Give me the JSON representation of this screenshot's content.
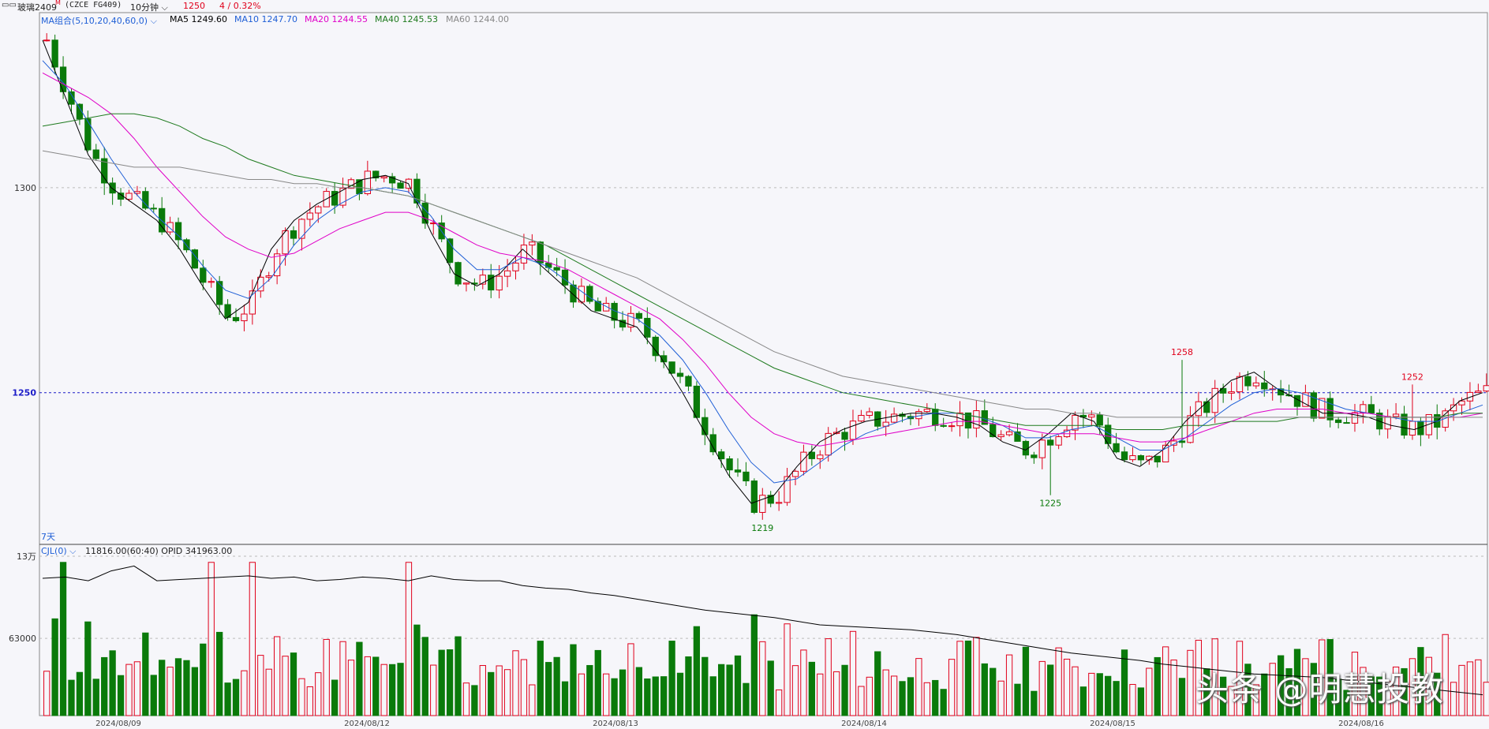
{
  "header": {
    "icon": "window-restore-icon",
    "symbol": "玻璃2409",
    "badge": "M",
    "code": "(CZCE FG409)",
    "period": "10分钟",
    "price": "1250",
    "change": "4 / 0.32%",
    "colors": {
      "price": "#e0001b",
      "change": "#e0001b"
    }
  },
  "ma_legend": {
    "group": "MA组合(5,10,20,40,60,0)",
    "items": [
      {
        "label": "MA5",
        "value": "1249.60",
        "color": "#000000"
      },
      {
        "label": "MA10",
        "value": "1247.70",
        "color": "#1f5fd6"
      },
      {
        "label": "MA20",
        "value": "1244.55",
        "color": "#e000c8"
      },
      {
        "label": "MA40",
        "value": "1245.53",
        "color": "#1e7a1e"
      },
      {
        "label": "MA60",
        "value": "1244.00",
        "color": "#888888"
      }
    ]
  },
  "volume_legend": {
    "label": "CJL(0)",
    "values": "11816.00(60:40)  OPID 341963.00"
  },
  "range_label": "7天",
  "watermark": "头条 @明慧投教",
  "colors": {
    "up": "#e0001b",
    "down": "#0a7a0a",
    "last_price_line": "#1c1cc8",
    "grid": "#bbbbbb"
  },
  "chart_data": {
    "type": "candlestick",
    "title": "",
    "price_axis": {
      "ticks": [
        1300,
        1250
      ],
      "highlight": 1250,
      "ylim": [
        1213,
        1340
      ]
    },
    "volume_axis": {
      "ticks": [
        "13万",
        "63000"
      ],
      "ylim": [
        0,
        130000
      ]
    },
    "x_labels": [
      "2024/08/09",
      "2024/08/12",
      "2024/08/13",
      "2024/08/14",
      "2024/08/15",
      "2024/08/16"
    ],
    "annotations": [
      {
        "text": "1258",
        "value": 1258,
        "kind": "high"
      },
      {
        "text": "1252",
        "value": 1252,
        "kind": "high"
      },
      {
        "text": "1219",
        "value": 1219,
        "kind": "low"
      },
      {
        "text": "1225",
        "value": 1225,
        "kind": "low"
      }
    ],
    "ma_series": [
      {
        "name": "MA5",
        "color": "#000000",
        "values": [
          1336,
          1322,
          1308,
          1300,
          1296,
          1292,
          1285,
          1276,
          1268,
          1272,
          1285,
          1292,
          1296,
          1299,
          1302,
          1303,
          1301,
          1289,
          1279,
          1276,
          1279,
          1285,
          1280,
          1275,
          1270,
          1268,
          1266,
          1259,
          1250,
          1240,
          1230,
          1223,
          1225,
          1232,
          1238,
          1241,
          1243,
          1244,
          1245,
          1245,
          1244,
          1242,
          1238,
          1236,
          1240,
          1245,
          1243,
          1234,
          1232,
          1236,
          1243,
          1248,
          1253,
          1255,
          1251,
          1248,
          1245,
          1245,
          1244,
          1242,
          1241,
          1243,
          1248,
          1250
        ]
      },
      {
        "name": "MA10",
        "color": "#1f5fd6",
        "values": [
          1331,
          1325,
          1316,
          1307,
          1299,
          1293,
          1288,
          1281,
          1275,
          1273,
          1278,
          1286,
          1292,
          1296,
          1299,
          1300,
          1299,
          1293,
          1285,
          1280,
          1280,
          1283,
          1281,
          1277,
          1273,
          1270,
          1268,
          1264,
          1258,
          1250,
          1241,
          1233,
          1228,
          1229,
          1233,
          1237,
          1240,
          1242,
          1244,
          1245,
          1245,
          1244,
          1242,
          1239,
          1239,
          1241,
          1242,
          1239,
          1236,
          1236,
          1239,
          1243,
          1247,
          1250,
          1251,
          1250,
          1248,
          1246,
          1245,
          1244,
          1243,
          1243,
          1245,
          1247
        ]
      },
      {
        "name": "MA20",
        "color": "#e000c8",
        "values": [
          1328,
          1325,
          1322,
          1318,
          1312,
          1305,
          1299,
          1293,
          1288,
          1285,
          1283,
          1284,
          1287,
          1290,
          1292,
          1294,
          1294,
          1292,
          1289,
          1286,
          1284,
          1283,
          1282,
          1280,
          1277,
          1274,
          1271,
          1268,
          1263,
          1257,
          1250,
          1244,
          1240,
          1238,
          1237,
          1238,
          1239,
          1240,
          1241,
          1242,
          1243,
          1243,
          1242,
          1241,
          1240,
          1240,
          1240,
          1239,
          1238,
          1238,
          1239,
          1241,
          1243,
          1245,
          1246,
          1246,
          1246,
          1245,
          1245,
          1244,
          1244,
          1244,
          1244,
          1245
        ]
      },
      {
        "name": "MA40",
        "color": "#1e7a1e",
        "values": [
          1315,
          1316,
          1317,
          1318,
          1318,
          1317,
          1315,
          1312,
          1310,
          1307,
          1305,
          1303,
          1302,
          1301,
          1300,
          1299,
          1298,
          1296,
          1294,
          1292,
          1290,
          1288,
          1286,
          1283,
          1280,
          1277,
          1274,
          1271,
          1268,
          1265,
          1262,
          1259,
          1256,
          1254,
          1252,
          1250,
          1249,
          1248,
          1247,
          1246,
          1245,
          1244,
          1243,
          1242,
          1242,
          1242,
          1242,
          1241,
          1241,
          1241,
          1242,
          1242,
          1243,
          1243,
          1243,
          1244,
          1244,
          1244,
          1244,
          1244,
          1244,
          1244,
          1245,
          1245
        ]
      },
      {
        "name": "MA60",
        "color": "#888888",
        "values": [
          1309,
          1308,
          1307,
          1306,
          1305,
          1305,
          1305,
          1304,
          1303,
          1302,
          1302,
          1301,
          1301,
          1300,
          1300,
          1299,
          1298,
          1296,
          1294,
          1292,
          1290,
          1288,
          1286,
          1284,
          1282,
          1280,
          1278,
          1275,
          1272,
          1269,
          1266,
          1263,
          1260,
          1258,
          1256,
          1254,
          1253,
          1252,
          1251,
          1250,
          1249,
          1248,
          1247,
          1246,
          1246,
          1245,
          1245,
          1244,
          1244,
          1244,
          1244,
          1244,
          1244,
          1244,
          1244,
          1244,
          1244,
          1244,
          1244,
          1244,
          1244,
          1244,
          1244,
          1244
        ]
      }
    ],
    "volume_ma": [
      112000,
      113000,
      110000,
      118000,
      122000,
      110000,
      111000,
      112000,
      113000,
      114000,
      112000,
      113000,
      110000,
      111000,
      113000,
      112000,
      110000,
      114000,
      111000,
      110000,
      110000,
      106000,
      104000,
      103000,
      100000,
      98000,
      95000,
      92000,
      89000,
      86000,
      84000,
      82000,
      80000,
      77000,
      74000,
      73000,
      72000,
      71000,
      70000,
      68000,
      66000,
      63000,
      60000,
      57000,
      54000,
      51000,
      49000,
      47000,
      45000,
      42000,
      40000,
      38000,
      36000,
      34000,
      33000,
      32000,
      31000,
      29000,
      27000,
      25000,
      23000,
      21000,
      19000,
      17000
    ]
  }
}
